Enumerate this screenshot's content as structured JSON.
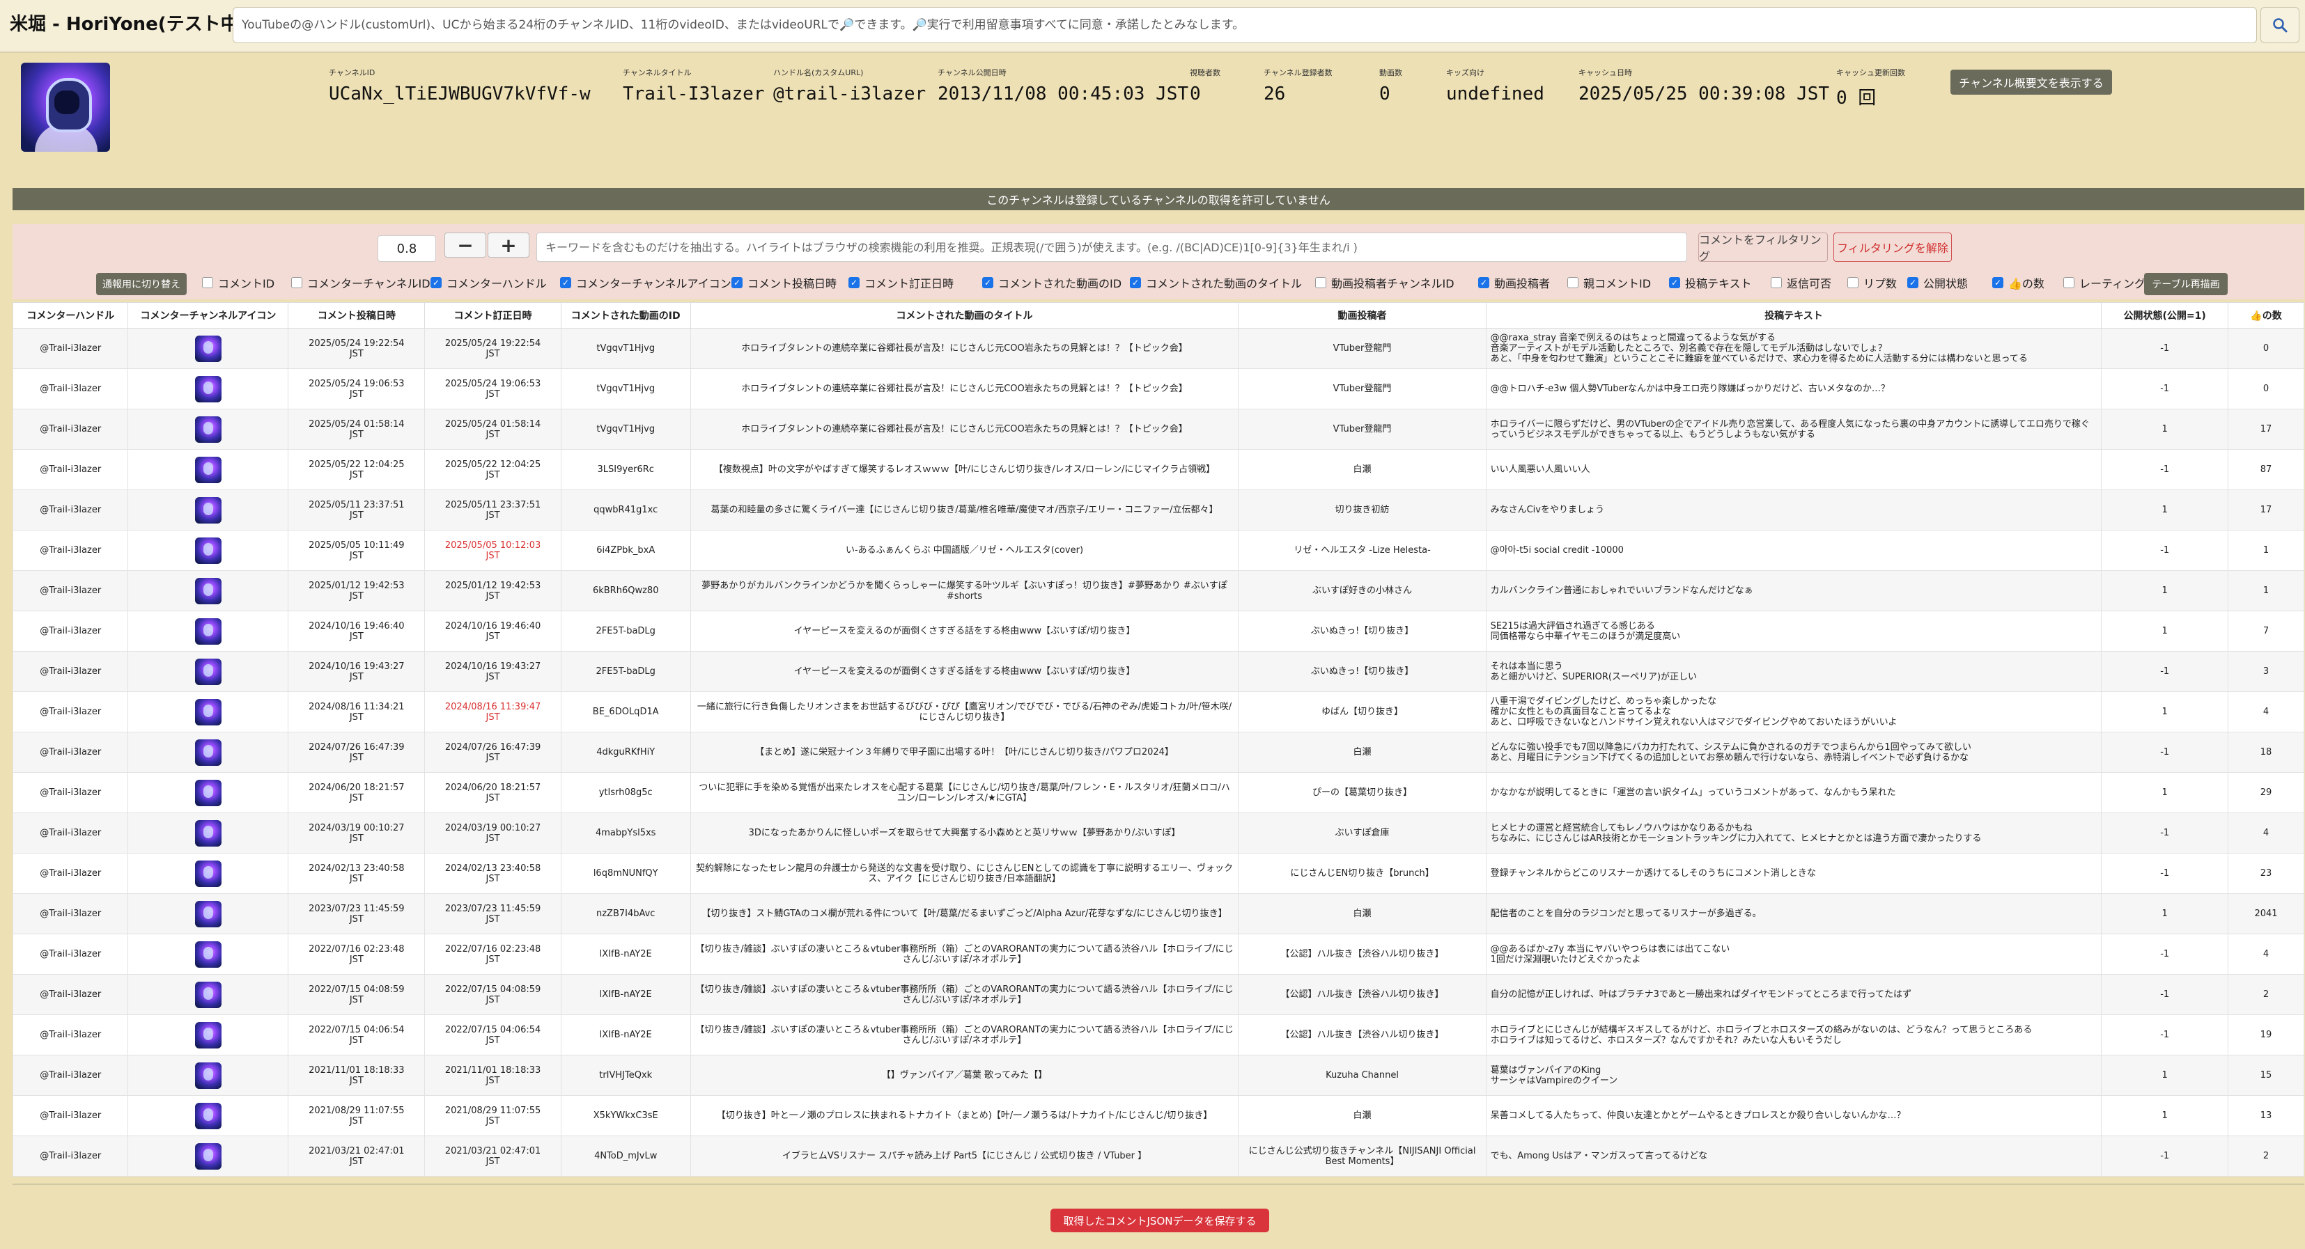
{
  "app": {
    "title": "米堀 - HoriYone(テスト中)"
  },
  "search": {
    "placeholder": "YouTubeの@ハンドル(customUrl)、UCから始まる24桁のチャンネルID、11桁のvideoID、またはvideoURLで🔎できます。🔎実行で利用留意事項すべてに同意・承諾したとみなします。",
    "icon": "search-icon"
  },
  "channel": {
    "avatar": "channel-avatar-image",
    "fields": [
      {
        "label": "チャンネルID",
        "value": "UCaNx_lTiEJWBUGV7kVfVf-w"
      },
      {
        "label": "チャンネルタイトル",
        "value": "Trail-I3lazer"
      },
      {
        "label": "ハンドル名(カスタムURL)",
        "value": "@trail-i3lazer"
      },
      {
        "label": "チャンネル公開日時",
        "value": "2013/11/08 00:45:03 JST"
      },
      {
        "label": "視聴者数",
        "value": "0"
      },
      {
        "label": "チャンネル登録者数",
        "value": "26"
      },
      {
        "label": "動画数",
        "value": "0"
      },
      {
        "label": "キッズ向け",
        "value": "undefined"
      },
      {
        "label": "キャッシュ日時",
        "value": "2025/05/25 00:39:08 JST"
      },
      {
        "label": "キャッシュ更新回数",
        "value": "0 回"
      }
    ],
    "show_description_label": "チャンネル概要文を表示する"
  },
  "warning": {
    "text": "このチャンネルは登録しているチャンネルの取得を許可していません"
  },
  "filter": {
    "threshold": "0.8",
    "minus_label": "−",
    "plus_label": "+",
    "keyword_placeholder": "キーワードを含むものだけを抽出する。ハイライトはブラウザの検索機能の利用を推奨。正規表現(/で囲う)が使えます。(e.g. /(BC|AD)CE)1[0-9]{3}年生まれ/i )",
    "filter_button": "コメントをフィルタリング",
    "clear_button": "フィルタリングを解除",
    "mode_switch": "通報用に切り替え",
    "redraw_button": "テーブル再描画",
    "columns": [
      {
        "label": "コメントID",
        "checked": false
      },
      {
        "label": "コメンターチャンネルID",
        "checked": false
      },
      {
        "label": "コメンターハンドル",
        "checked": true
      },
      {
        "label": "コメンターチャンネルアイコン",
        "checked": true
      },
      {
        "label": "コメント投稿日時",
        "checked": true
      },
      {
        "label": "コメント訂正日時",
        "checked": true
      },
      {
        "label": "コメントされた動画のID",
        "checked": true
      },
      {
        "label": "コメントされた動画のタイトル",
        "checked": true
      },
      {
        "label": "動画投稿者チャンネルID",
        "checked": false
      },
      {
        "label": "動画投稿者",
        "checked": true
      },
      {
        "label": "親コメントID",
        "checked": false
      },
      {
        "label": "投稿テキスト",
        "checked": true
      },
      {
        "label": "返信可否",
        "checked": false
      },
      {
        "label": "リプ数",
        "checked": false
      },
      {
        "label": "公開状態",
        "checked": true
      },
      {
        "label": "👍の数",
        "checked": true
      },
      {
        "label": "レーティング",
        "checked": false
      }
    ]
  },
  "table": {
    "headers": [
      "コメンターハンドル",
      "コメンターチャンネルアイコン",
      "コメント投稿日時",
      "コメント訂正日時",
      "コメントされた動画のID",
      "コメントされた動画のタイトル",
      "動画投稿者",
      "投稿テキスト",
      "公開状態(公開=1)",
      "👍の数"
    ],
    "rows": [
      {
        "handle": "@Trail-i3lazer",
        "posted": "2025/05/24 19:22:54\nJST",
        "edited": "2025/05/24 19:22:54\nJST",
        "edited_red": false,
        "video_id": "tVgqvT1Hjvg",
        "video_title": "ホロライブタレントの連続卒業に谷郷社長が言及！にじさんじ元COO岩永たちの見解とは！？【トピック会】",
        "uploader": "VTuber登龍門",
        "text": "@@raxa_stray 音楽で例えるのはちょっと間違ってるような気がする\n音楽アーティストがモデル活動したところで、別名義で存在を隠してモデル活動はしないでしょ？\nあと、「中身を匂わせて難演」ということこそに難癖を並べているだけで、求心力を得るために人活動する分には構わないと思ってる",
        "public": "-1",
        "likes": "0"
      },
      {
        "handle": "@Trail-i3lazer",
        "posted": "2025/05/24 19:06:53\nJST",
        "edited": "2025/05/24 19:06:53\nJST",
        "edited_red": false,
        "video_id": "tVgqvT1Hjvg",
        "video_title": "ホロライブタレントの連続卒業に谷郷社長が言及！にじさんじ元COO岩永たちの見解とは！？【トピック会】",
        "uploader": "VTuber登龍門",
        "text": "@@トロハチ-e3w 個人勢VTuberなんかは中身エロ売り隊嫌ばっかりだけど、古いメタなのか…？",
        "public": "-1",
        "likes": "0"
      },
      {
        "handle": "@Trail-i3lazer",
        "posted": "2025/05/24 01:58:14\nJST",
        "edited": "2025/05/24 01:58:14\nJST",
        "edited_red": false,
        "video_id": "tVgqvT1Hjvg",
        "video_title": "ホロライブタレントの連続卒業に谷郷社長が言及！にじさんじ元COO岩永たちの見解とは！？【トピック会】",
        "uploader": "VTuber登龍門",
        "text": "ホロライバーに限らずだけど、男のVTuberの企でアイドル売り恋営業して、ある程度人気になったら裏の中身アカウントに誘導してエロ売りで稼ぐっていうビジネスモデルができちゃってる以上、もうどうしようもない気がする",
        "public": "1",
        "likes": "17"
      },
      {
        "handle": "@Trail-i3lazer",
        "posted": "2025/05/22 12:04:25\nJST",
        "edited": "2025/05/22 12:04:25\nJST",
        "edited_red": false,
        "video_id": "3LSI9yer6Rc",
        "video_title": "【複数視点】叶の文字がやばすぎて爆笑するレオスｗｗｗ【叶/にじさんじ切り抜き/レオス/ローレン/にじマイクラ占領戦】",
        "uploader": "白瀬",
        "text": "いい人風悪い人風いい人",
        "public": "-1",
        "likes": "87"
      },
      {
        "handle": "@Trail-i3lazer",
        "posted": "2025/05/11 23:37:51\nJST",
        "edited": "2025/05/11 23:37:51\nJST",
        "edited_red": false,
        "video_id": "qqwbR41g1xc",
        "video_title": "葛葉の和睦量の多さに驚くライバー達【にじさんじ切り抜き/葛葉/椎名唯華/魔使マオ/西京子/エリー・コニファー/立伝都々】",
        "uploader": "切り抜き初紡",
        "text": "みなさんCivをやりましょう",
        "public": "1",
        "likes": "17"
      },
      {
        "handle": "@Trail-i3lazer",
        "posted": "2025/05/05 10:11:49\nJST",
        "edited": "2025/05/05 10:12:03\nJST",
        "edited_red": true,
        "video_id": "6i4ZPbk_bxA",
        "video_title": "い-あるふぁんくらぶ 中国語版／リゼ・ヘルエスタ(cover)",
        "uploader": "リゼ・ヘルエスタ -Lize Helesta-",
        "text": "@아아-t5i social credit -10000",
        "public": "-1",
        "likes": "1"
      },
      {
        "handle": "@Trail-i3lazer",
        "posted": "2025/01/12 19:42:53\nJST",
        "edited": "2025/01/12 19:42:53\nJST",
        "edited_red": false,
        "video_id": "6kBRh6Qwz80",
        "video_title": "夢野あかりがカルバンクラインかどうかを聞くらっしゃーに爆笑する叶ツルギ【ぶいすぽっ！切り抜き】#夢野あかり #ぶいすぽ #shorts",
        "uploader": "ぶいすぽ好きの小林さん",
        "text": "カルバンクライン普通におしゃれでいいブランドなんだけどなぁ",
        "public": "1",
        "likes": "1"
      },
      {
        "handle": "@Trail-i3lazer",
        "posted": "2024/10/16 19:46:40\nJST",
        "edited": "2024/10/16 19:46:40\nJST",
        "edited_red": false,
        "video_id": "2FE5T-baDLg",
        "video_title": "イヤーピースを変えるのが面倒くさすぎる話をする柊由www【ぶいすぽ/切り抜き】",
        "uploader": "ぶいぬきっ!【切り抜き】",
        "text": "SE215は過大評価され過ぎてる感じある\n同価格帯なら中華イヤモニのほうが満足度高い",
        "public": "1",
        "likes": "7"
      },
      {
        "handle": "@Trail-i3lazer",
        "posted": "2024/10/16 19:43:27\nJST",
        "edited": "2024/10/16 19:43:27\nJST",
        "edited_red": false,
        "video_id": "2FE5T-baDLg",
        "video_title": "イヤーピースを変えるのが面倒くさすぎる話をする柊由www【ぶいすぽ/切り抜き】",
        "uploader": "ぶいぬきっ!【切り抜き】",
        "text": "それは本当に思う\nあと細かいけど、SUPERIOR(スーペリア)が正しい",
        "public": "-1",
        "likes": "3"
      },
      {
        "handle": "@Trail-i3lazer",
        "posted": "2024/08/16 11:34:21\nJST",
        "edited": "2024/08/16 11:39:47\nJST",
        "edited_red": true,
        "video_id": "BE_6DOLqD1A",
        "video_title": "一緒に旅行に行き負傷したリオンさまをお世話するびびび・ぴぴ【鷹宮リオン/でびでび・でびる/石神のぞみ/虎姫コトカ/叶/笹木咲/にじさんじ切り抜き】",
        "uploader": "ゆばん【切り抜き】",
        "text": "八重干潟でダイビングしたけど、めっちゃ楽しかったな\n確かに女性ともの真面目なこと言ってるよな\nあと、口呼吸できないなとハンドサイン覚えれない人はマジでダイビングやめておいたほうがいいよ",
        "public": "1",
        "likes": "4"
      },
      {
        "handle": "@Trail-i3lazer",
        "posted": "2024/07/26 16:47:39\nJST",
        "edited": "2024/07/26 16:47:39\nJST",
        "edited_red": false,
        "video_id": "4dkguRKfHiY",
        "video_title": "【まとめ】遂に栄冠ナイン３年縛りで甲子園に出場する叶！【叶/にじさんじ切り抜き/パワプロ2024】",
        "uploader": "白瀬",
        "text": "どんなに強い投手でも7回以降急にバカ力打たれて、システムに負かされるのガチでつまらんから1回やってみて欲しい\nあと、月曜日にテンション下げてくるの追加しといてお祭め頼んで行けないなら、赤特消しイベントで必ず負けるかな",
        "public": "-1",
        "likes": "18"
      },
      {
        "handle": "@Trail-i3lazer",
        "posted": "2024/06/20 18:21:57\nJST",
        "edited": "2024/06/20 18:21:57\nJST",
        "edited_red": false,
        "video_id": "ytIsrh08g5c",
        "video_title": "ついに犯罪に手を染める覚悟が出来たレオスを心配する葛葉【にじさんじ/切り抜き/葛葉/叶/フレン・E・ルスタリオ/狂蘭メロコ/ハユン/ローレン/レオス/★にGTA】",
        "uploader": "ぴーの【葛葉切り抜き】",
        "text": "かなかなが説明してるときに「運営の言い訳タイム」っていうコメントがあって、なんかもう呆れた",
        "public": "1",
        "likes": "29"
      },
      {
        "handle": "@Trail-i3lazer",
        "posted": "2024/03/19 00:10:27\nJST",
        "edited": "2024/03/19 00:10:27\nJST",
        "edited_red": false,
        "video_id": "4mabpYsl5xs",
        "video_title": "3Dになったあかりんに怪しいポーズを取らせて大興奮する小森めとと英リサｗｗ【夢野あかり/ぶいすぽ】",
        "uploader": "ぶいすぽ倉庫",
        "text": "ヒメヒナの運営と経営統合してもレノウハウはかなりあるかもね\nちなみに、にじさんじはAR技術とかモーショントラッキングに力入れてて、ヒメヒナとかとは違う方面で凄かったりする",
        "public": "-1",
        "likes": "4"
      },
      {
        "handle": "@Trail-i3lazer",
        "posted": "2024/02/13 23:40:58\nJST",
        "edited": "2024/02/13 23:40:58\nJST",
        "edited_red": false,
        "video_id": "l6q8mNUNfQY",
        "video_title": "契約解除になったセレン龍月の弁護士から発送的な文書を受け取り、にじさんじENとしての認識を丁寧に説明するエリー、ヴォックス、アイク【にじさんじ切り抜き/日本語翻訳】",
        "uploader": "にじさんじEN切り抜き【brunch】",
        "text": "登録チャンネルからどこのリスナーか透けてるしそのうちにコメント消しときな",
        "public": "-1",
        "likes": "23"
      },
      {
        "handle": "@Trail-i3lazer",
        "posted": "2023/07/23 11:45:59\nJST",
        "edited": "2023/07/23 11:45:59\nJST",
        "edited_red": false,
        "video_id": "nzZB7I4bAvc",
        "video_title": "【切り抜き】スト鯖GTAのコメ欄が荒れる件について【叶/葛葉/だるまいずごっど/Alpha Azur/花芽なずな/にじさんじ切り抜き】",
        "uploader": "白瀬",
        "text": "配信者のことを自分のラジコンだと思ってるリスナーが多過ぎる。",
        "public": "1",
        "likes": "2041"
      },
      {
        "handle": "@Trail-i3lazer",
        "posted": "2022/07/16 02:23:48\nJST",
        "edited": "2022/07/16 02:23:48\nJST",
        "edited_red": false,
        "video_id": "lXIfB-nAY2E",
        "video_title": "【切り抜き/雑談】ぶいすぽの凄いところ＆vtuber事務所所（箱）ごとのVARORANTの実力について語る渋谷ハル【ホロライブ/にじさんじ/ぶいすぽ/ネオポルテ】",
        "uploader": "【公認】ハル抜き【渋谷ハル切り抜き】",
        "text": "@@あるばか-z7y 本当にヤバいやつらは表には出てこない\n1回だけ深淵覗いたけどえぐかったよ",
        "public": "-1",
        "likes": "4"
      },
      {
        "handle": "@Trail-i3lazer",
        "posted": "2022/07/15 04:08:59\nJST",
        "edited": "2022/07/15 04:08:59\nJST",
        "edited_red": false,
        "video_id": "lXIfB-nAY2E",
        "video_title": "【切り抜き/雑談】ぶいすぽの凄いところ＆vtuber事務所所（箱）ごとのVARORANTの実力について語る渋谷ハル【ホロライブ/にじさんじ/ぶいすぽ/ネオポルテ】",
        "uploader": "【公認】ハル抜き【渋谷ハル切り抜き】",
        "text": "自分の記憶が正しければ、叶はプラチナ3であと一勝出来ればダイヤモンドってところまで行ってたはず",
        "public": "-1",
        "likes": "2"
      },
      {
        "handle": "@Trail-i3lazer",
        "posted": "2022/07/15 04:06:54\nJST",
        "edited": "2022/07/15 04:06:54\nJST",
        "edited_red": false,
        "video_id": "lXIfB-nAY2E",
        "video_title": "【切り抜き/雑談】ぶいすぽの凄いところ＆vtuber事務所所（箱）ごとのVARORANTの実力について語る渋谷ハル【ホロライブ/にじさんじ/ぶいすぽ/ネオポルテ】",
        "uploader": "【公認】ハル抜き【渋谷ハル切り抜き】",
        "text": "ホロライブとにじさんじが結構ギスギスしてるがけど、ホロライブとホロスターズの絡みがないのは、どうなん？って思うところある\nホロライブは知ってるけど、ホロスターズ？なんですかそれ？みたいな人もいそうだし",
        "public": "-1",
        "likes": "19"
      },
      {
        "handle": "@Trail-i3lazer",
        "posted": "2021/11/01 18:18:33\nJST",
        "edited": "2021/11/01 18:18:33\nJST",
        "edited_red": false,
        "video_id": "trIVHJTeQxk",
        "video_title": "【】ヴァンパイア／葛葉 歌ってみた【】",
        "uploader": "Kuzuha Channel",
        "text": "葛葉はヴァンパイアのKing\nサーシャはVampireのクイーン",
        "public": "1",
        "likes": "15"
      },
      {
        "handle": "@Trail-i3lazer",
        "posted": "2021/08/29 11:07:55\nJST",
        "edited": "2021/08/29 11:07:55\nJST",
        "edited_red": false,
        "video_id": "X5kYWkxC3sE",
        "video_title": "【切り抜き】叶と一ノ瀬のプロレスに挟まれるトナカイト（まとめ)【叶/一ノ瀬うるは/トナカイト/にじさんじ/切り抜き】",
        "uploader": "白瀬",
        "text": "呆善コメしてる人たちって、仲良い友達とかとゲームやるときプロレスとか殺り合いしないんかな…？",
        "public": "1",
        "likes": "13"
      },
      {
        "handle": "@Trail-i3lazer",
        "posted": "2021/03/21 02:47:01\nJST",
        "edited": "2021/03/21 02:47:01\nJST",
        "edited_red": false,
        "video_id": "4NToD_mJvLw",
        "video_title": "イブラヒムVSリスナー スパチャ読み上げ Part5【にじさんじ / 公式切り抜き / VTuber 】",
        "uploader": "にじさんじ公式切り抜きチャンネル【NIJISANJI Official Best Moments】",
        "text": "でも、Among Usはア・マンガスって言ってるけどな",
        "public": "-1",
        "likes": "2"
      }
    ]
  },
  "footer": {
    "save_label": "取得したコメントJSONデータを保存する"
  }
}
